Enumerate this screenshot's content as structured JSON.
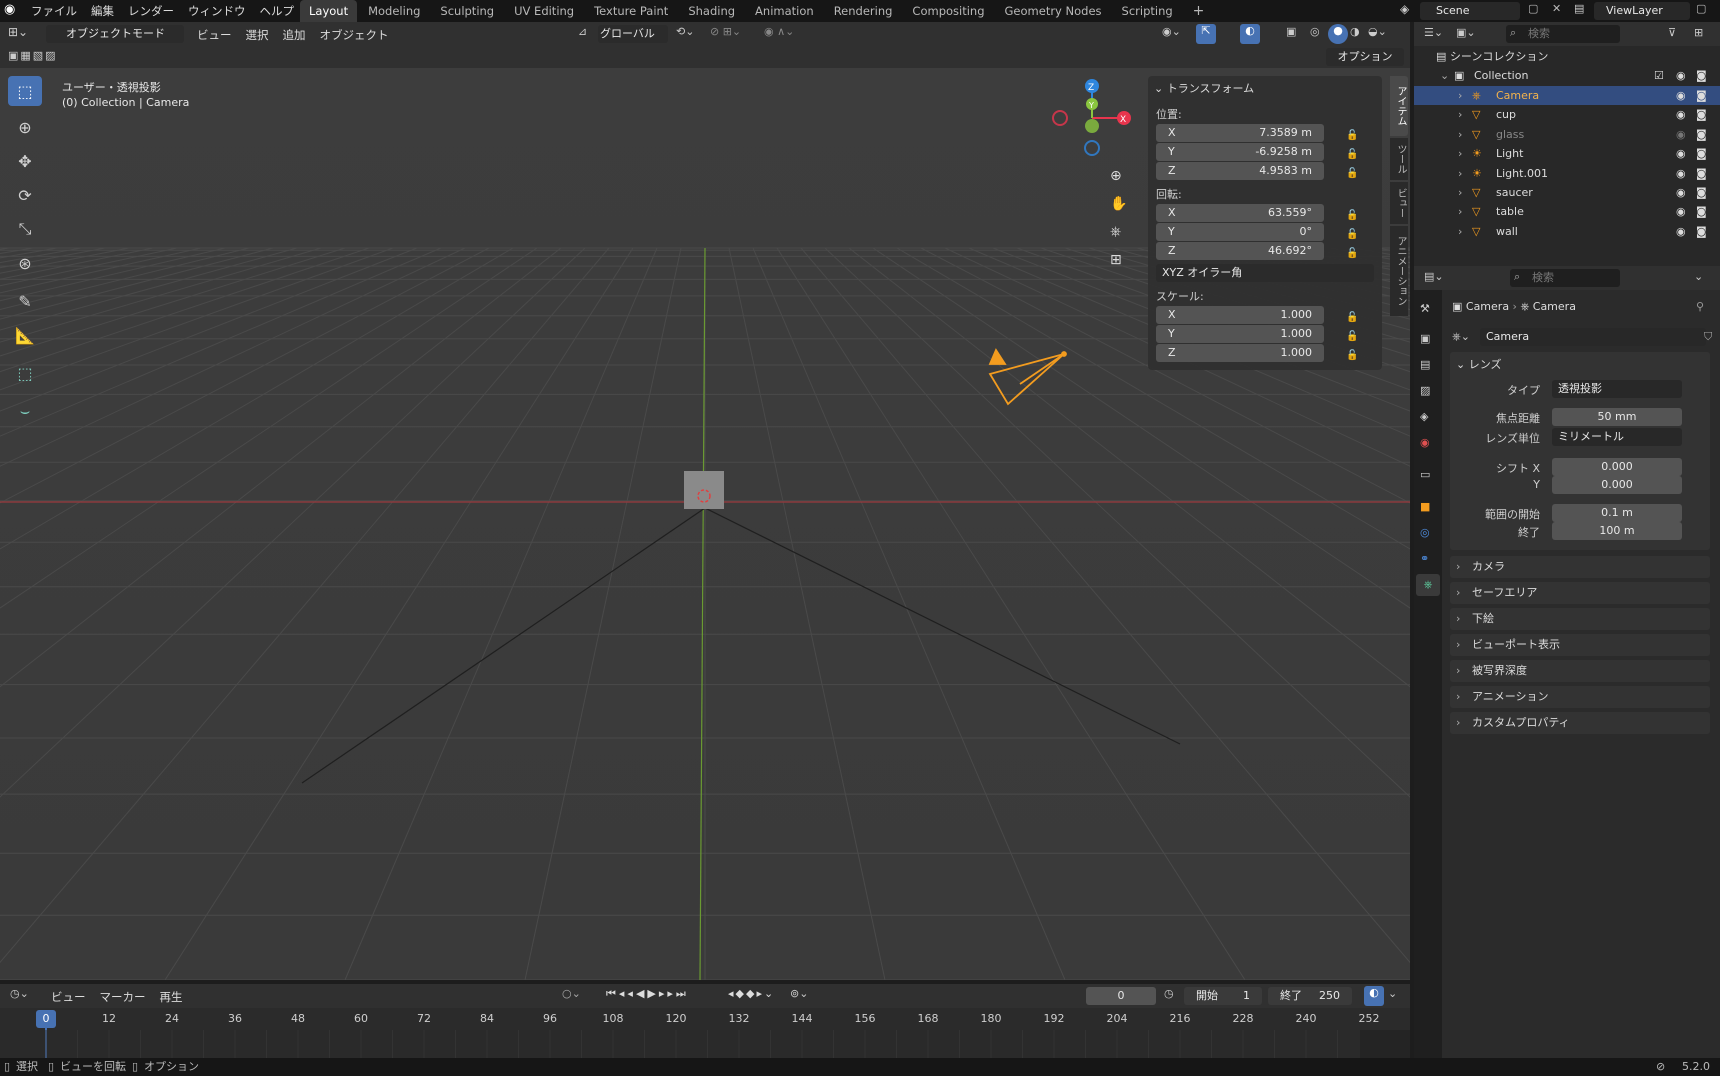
{
  "topbar": {
    "menus": [
      "ファイル",
      "編集",
      "レンダー",
      "ウィンドウ",
      "ヘルプ"
    ],
    "workspaces": [
      "Layout",
      "Modeling",
      "Sculpting",
      "UV Editing",
      "Texture Paint",
      "Shading",
      "Animation",
      "Rendering",
      "Compositing",
      "Geometry Nodes",
      "Scripting"
    ],
    "active_workspace": "Layout",
    "scene": "Scene",
    "view_layer": "ViewLayer"
  },
  "viewport_header": {
    "mode": "オブジェクトモード",
    "menus": [
      "ビュー",
      "選択",
      "追加",
      "オブジェクト"
    ],
    "orientation": "グローバル",
    "options": "オプション"
  },
  "viewport": {
    "title": "ユーザー・透視投影",
    "subtitle": "(0) Collection | Camera"
  },
  "gizmo": {
    "z": "Z",
    "y": "Y",
    "x": "X"
  },
  "transform_panel": {
    "title": "トランスフォーム",
    "location_label": "位置:",
    "location": {
      "x": "7.3589 m",
      "y": "-6.9258 m",
      "z": "4.9583 m"
    },
    "rotation_label": "回転:",
    "rotation": {
      "x": "63.559°",
      "y": "0°",
      "z": "46.692°"
    },
    "rotation_mode": "XYZ オイラー角",
    "scale_label": "スケール:",
    "scale": {
      "x": "1.000",
      "y": "1.000",
      "z": "1.000"
    },
    "axis": {
      "x": "X",
      "y": "Y",
      "z": "Z"
    }
  },
  "side_tabs": [
    "アイテム",
    "ツール",
    "ビュー",
    "アニメーション"
  ],
  "outliner": {
    "search_placeholder": "検索",
    "scene_collection": "シーンコレクション",
    "collection": "Collection",
    "items": [
      {
        "name": "Camera",
        "selected": true,
        "dim": false
      },
      {
        "name": "cup",
        "selected": false,
        "dim": false
      },
      {
        "name": "glass",
        "selected": false,
        "dim": true
      },
      {
        "name": "Light",
        "selected": false,
        "dim": false
      },
      {
        "name": "Light.001",
        "selected": false,
        "dim": false
      },
      {
        "name": "saucer",
        "selected": false,
        "dim": false
      },
      {
        "name": "table",
        "selected": false,
        "dim": false
      },
      {
        "name": "wall",
        "selected": false,
        "dim": false
      }
    ]
  },
  "properties": {
    "search_placeholder": "検索",
    "breadcrumb_object": "Camera",
    "breadcrumb_data": "Camera",
    "data_name": "Camera",
    "lens_section": "レンズ",
    "type_label": "タイプ",
    "type_value": "透視投影",
    "focal_label": "焦点距離",
    "focal_value": "50 mm",
    "lens_unit_label": "レンズ単位",
    "lens_unit_value": "ミリメートル",
    "shift_x_label": "シフト X",
    "shift_x_value": "0.000",
    "shift_y_label": "Y",
    "shift_y_value": "0.000",
    "clip_start_label": "範囲の開始",
    "clip_start_value": "0.1 m",
    "clip_end_label": "終了",
    "clip_end_value": "100 m",
    "sections": [
      "カメラ",
      "セーフエリア",
      "下絵",
      "ビューポート表示",
      "被写界深度",
      "アニメーション",
      "カスタムプロパティ"
    ]
  },
  "timeline": {
    "menus": [
      "ビュー",
      "マーカー",
      "再生"
    ],
    "current_frame": "0",
    "start_label": "開始",
    "start_value": "1",
    "end_label": "終了",
    "end_value": "250",
    "ticks": [
      "12",
      "24",
      "36",
      "48",
      "60",
      "72",
      "84",
      "96",
      "108",
      "120",
      "132",
      "144",
      "156",
      "168",
      "180",
      "192",
      "204",
      "216",
      "228",
      "240",
      "252"
    ],
    "playhead": "0"
  },
  "statusbar": {
    "select": "選択",
    "rotate": "ビューを回転",
    "options": "オプション",
    "version": "5.2.0"
  },
  "colors": {
    "accent": "#4772b3",
    "camera": "#f39c1f",
    "selected_row": "#334d80",
    "x_axis": "#e8354d",
    "y_axis": "#8ac63f",
    "z_axis": "#2e86de"
  }
}
